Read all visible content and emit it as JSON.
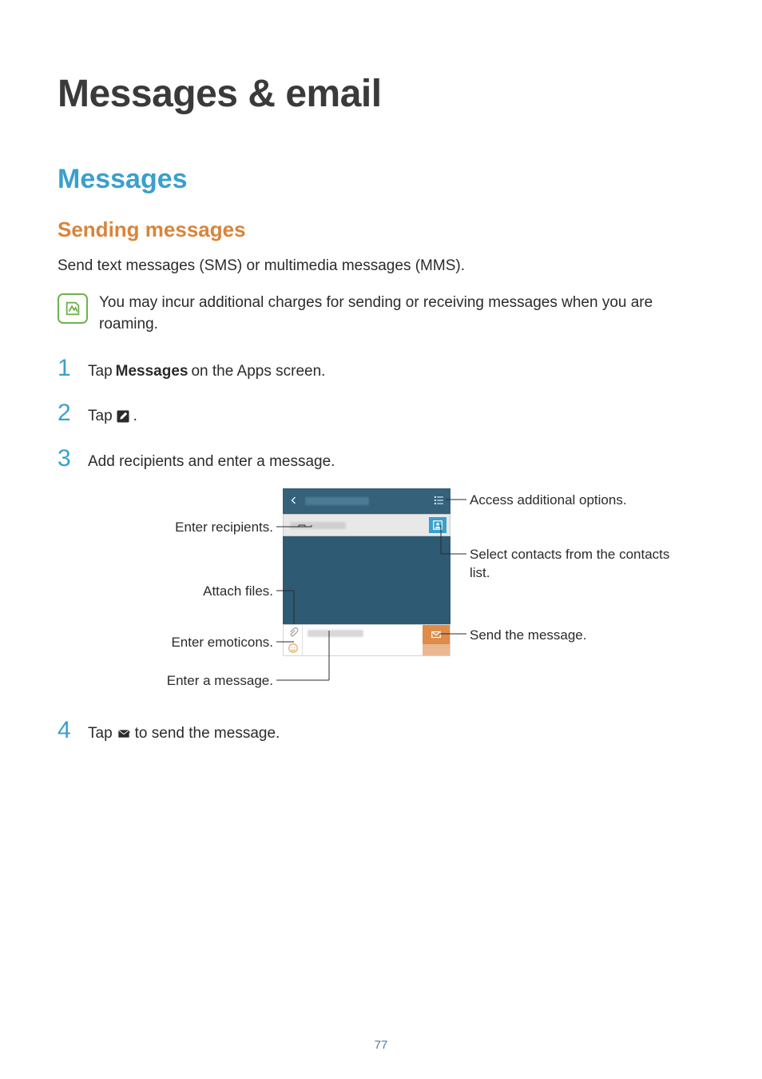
{
  "page": {
    "title": "Messages & email",
    "section": "Messages",
    "subsection": "Sending messages",
    "intro": "Send text messages (SMS) or multimedia messages (MMS).",
    "note": "You may incur additional charges for sending or receiving messages when you are roaming.",
    "page_number": "77"
  },
  "steps": {
    "s1": {
      "num": "1",
      "pre": "Tap ",
      "bold": "Messages",
      "post": " on the Apps screen."
    },
    "s2": {
      "num": "2",
      "pre": "Tap ",
      "post": "."
    },
    "s3": {
      "num": "3",
      "text": "Add recipients and enter a message."
    },
    "s4": {
      "num": "4",
      "pre": "Tap ",
      "post": " to send the message."
    }
  },
  "callouts": {
    "enter_recipients": "Enter recipients.",
    "attach_files": "Attach files.",
    "enter_emoticons": "Enter emoticons.",
    "enter_message": "Enter a message.",
    "access_options": "Access additional options.",
    "select_contacts": "Select contacts from the contacts list.",
    "send_message": "Send the message."
  },
  "icons": {
    "note": "note-icon",
    "compose": "compose-icon",
    "send": "send-envelope-icon",
    "back": "back-chevron-icon",
    "more": "more-menu-icon",
    "contact": "contact-icon",
    "attach": "paperclip-icon",
    "emoticon": "smiley-icon"
  },
  "colors": {
    "accent_blue": "#3aa0cc",
    "accent_orange": "#d98439",
    "accent_green": "#6fb24c",
    "dark_teal": "#2f5a74"
  }
}
